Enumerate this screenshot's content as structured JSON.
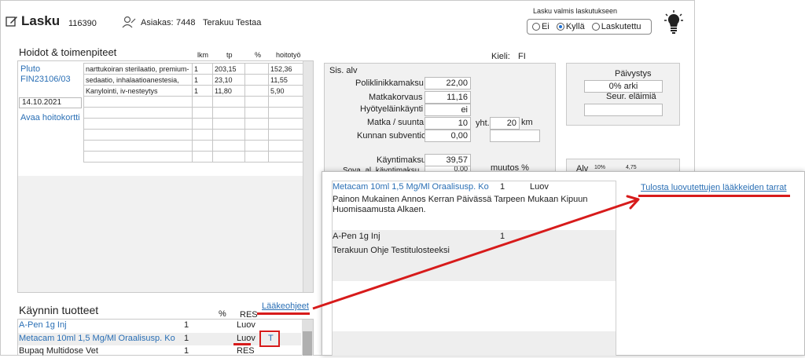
{
  "header": {
    "title": "Lasku",
    "invoice_no": "116390",
    "customer_label": "Asiakas:",
    "customer_id": "7448",
    "customer_name": "Terakuu Testaa"
  },
  "ready_group": {
    "title": "Lasku valmis laskutukseen",
    "options": [
      "Ei",
      "Kyllä",
      "Laskutettu"
    ],
    "selected": "Kyllä"
  },
  "treatments": {
    "title": "Hoidot & toimenpiteet",
    "columns": [
      "lkm",
      "tp",
      "%",
      "hoitotyö"
    ],
    "patient_name": "Pluto",
    "patient_id": "FIN23106/03",
    "date": "14.10.2021",
    "open_card": "Avaa hoitokortti",
    "rows": [
      {
        "desc": "narttukoiran sterilaatio, premium-",
        "lkm": "1",
        "tp": "203,15",
        "pct": "",
        "work": "152,36"
      },
      {
        "desc": "sedaatio, inhalaatioanestesia,",
        "lkm": "1",
        "tp": "23,10",
        "pct": "",
        "work": "11,55"
      },
      {
        "desc": "Kanylointi, iv-nesteytys",
        "lkm": "1",
        "tp": "11,80",
        "pct": "",
        "work": "5,90"
      }
    ]
  },
  "fees": {
    "lang_label": "Kieli:",
    "lang": "FI",
    "vat_label": "Sis. alv",
    "polyclinic_label": "Poliklinikkamaksu",
    "polyclinic": "22,00",
    "travel_label": "Matkakorvaus",
    "travel": "11,16",
    "benefit_label": "Hyötyeläinkäynti",
    "benefit": "ei",
    "trip_label": "Matka / suunta",
    "trip": "10",
    "total_label": "yht.",
    "total": "20",
    "unit": "km",
    "subsidy_label": "Kunnan subventio",
    "subsidy": "0,00",
    "visit_label": "Käyntimaksu",
    "visit": "39,57",
    "partial_label": "Sova. al. käyntimaksu",
    "partial_value": "0,00",
    "muutos_label": "muutos %"
  },
  "duty": {
    "title": "Päivystys",
    "value": "0% arki",
    "next_label": "Seur. eläimiä",
    "alv_label": "Alv",
    "alv_a": "10%",
    "alv_b": "4,75"
  },
  "products": {
    "title": "Käynnin tuotteet",
    "col_pct": "%",
    "col_res": "RES",
    "instructions_link": "Lääkeohjeet",
    "rows": [
      {
        "name": "A-Pen 1g Inj",
        "qty": "1",
        "res": "Luov",
        "t": ""
      },
      {
        "name": "Metacam 10ml 1,5 Mg/Ml Oraalisusp. Ko",
        "qty": "1",
        "res": "Luov",
        "t": "T"
      },
      {
        "name": "Bupaq Multidose Vet",
        "qty": "1",
        "res": "RES",
        "t": ""
      }
    ]
  },
  "popup": {
    "print_link": "Tulosta luovutettujen lääkkeiden tarrat",
    "items": [
      {
        "name": "Metacam 10ml 1,5 Mg/Ml Oraalisusp. Ko",
        "qty": "1",
        "status": "Luov",
        "instructions": "Painon Mukainen Annos Kerran Päivässä Tarpeen Mukaan Kipuun Huomisaamusta Alkaen."
      },
      {
        "name": "A-Pen 1g Inj",
        "qty": "1",
        "status": "",
        "instructions": "Terakuun Ohje Testitulosteeksi"
      }
    ]
  },
  "colors": {
    "annotation": "#d71b1b",
    "link": "#2a6fb5",
    "radio_selected": "#1a6fd6"
  }
}
